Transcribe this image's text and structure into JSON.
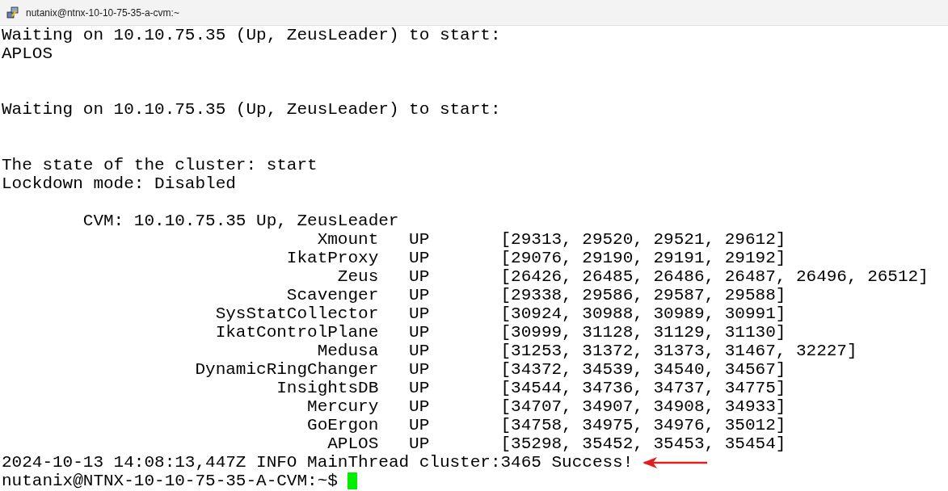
{
  "window": {
    "title": "nutanix@ntnx-10-10-75-35-a-cvm:~"
  },
  "terminal": {
    "lines": [
      {
        "kind": "text",
        "text": "Waiting on 10.10.75.35 (Up, ZeusLeader) to start:"
      },
      {
        "kind": "text",
        "text": "APLOS"
      },
      {
        "kind": "blank"
      },
      {
        "kind": "blank"
      },
      {
        "kind": "text",
        "text": "Waiting on 10.10.75.35 (Up, ZeusLeader) to start:"
      },
      {
        "kind": "blank"
      },
      {
        "kind": "blank"
      },
      {
        "kind": "text",
        "text": "The state of the cluster: start"
      },
      {
        "kind": "text",
        "text": "Lockdown mode: Disabled"
      },
      {
        "kind": "blank"
      },
      {
        "kind": "indented",
        "text": "CVM: 10.10.75.35 Up, ZeusLeader"
      },
      {
        "kind": "service",
        "name": "Xmount",
        "status": "UP",
        "pids": "[29313, 29520, 29521, 29612]"
      },
      {
        "kind": "service",
        "name": "IkatProxy",
        "status": "UP",
        "pids": "[29076, 29190, 29191, 29192]"
      },
      {
        "kind": "service",
        "name": "Zeus",
        "status": "UP",
        "pids": "[26426, 26485, 26486, 26487, 26496, 26512]"
      },
      {
        "kind": "service",
        "name": "Scavenger",
        "status": "UP",
        "pids": "[29338, 29586, 29587, 29588]"
      },
      {
        "kind": "service",
        "name": "SysStatCollector",
        "status": "UP",
        "pids": "[30924, 30988, 30989, 30991]"
      },
      {
        "kind": "service",
        "name": "IkatControlPlane",
        "status": "UP",
        "pids": "[30999, 31128, 31129, 31130]"
      },
      {
        "kind": "service",
        "name": "Medusa",
        "status": "UP",
        "pids": "[31253, 31372, 31373, 31467, 32227]"
      },
      {
        "kind": "service",
        "name": "DynamicRingChanger",
        "status": "UP",
        "pids": "[34372, 34539, 34540, 34567]"
      },
      {
        "kind": "service",
        "name": "InsightsDB",
        "status": "UP",
        "pids": "[34544, 34736, 34737, 34775]"
      },
      {
        "kind": "service",
        "name": "Mercury",
        "status": "UP",
        "pids": "[34707, 34907, 34908, 34933]"
      },
      {
        "kind": "service",
        "name": "GoErgon",
        "status": "UP",
        "pids": "[34758, 34975, 34976, 35012]"
      },
      {
        "kind": "service",
        "name": "APLOS",
        "status": "UP",
        "pids": "[35298, 35452, 35453, 35454]"
      },
      {
        "kind": "text",
        "text": "2024-10-13 14:08:13,447Z INFO MainThread cluster:3465 Success!",
        "annotated": true
      },
      {
        "kind": "prompt",
        "text": "nutanix@NTNX-10-10-75-35-A-CVM:~$"
      }
    ]
  }
}
